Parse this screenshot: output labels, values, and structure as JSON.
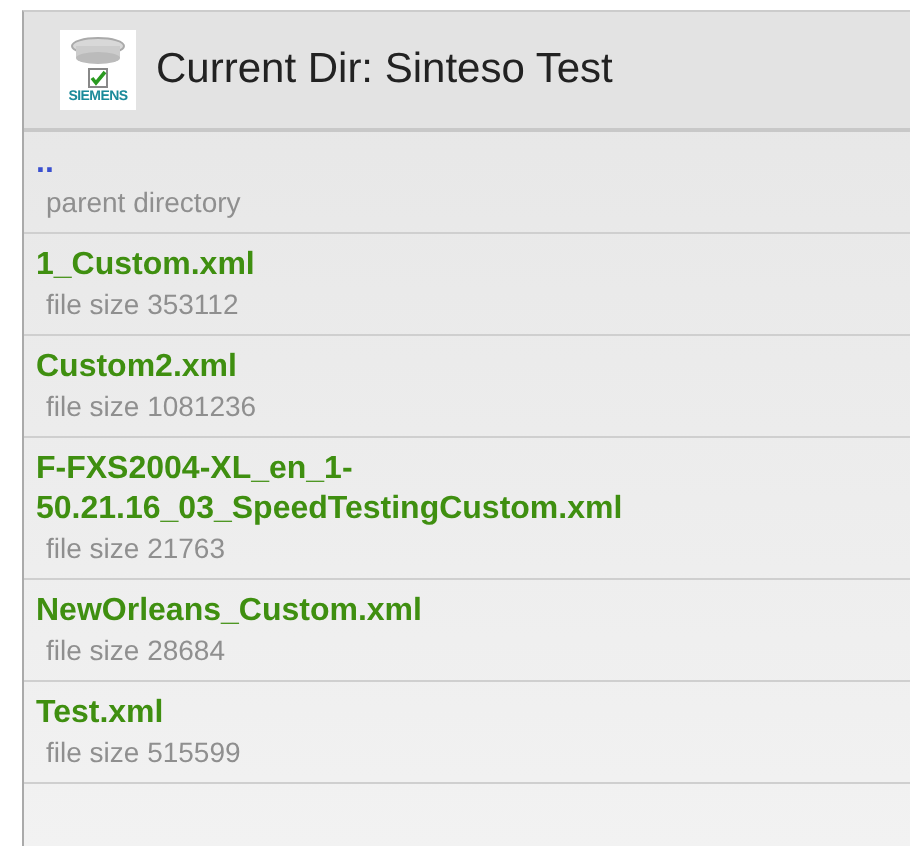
{
  "header": {
    "logo_text": "SIEMENS",
    "title": "Current Dir: Sinteso Test"
  },
  "entries": [
    {
      "kind": "parent",
      "name": "..",
      "detail": "parent directory"
    },
    {
      "kind": "file",
      "name": "1_Custom.xml",
      "detail": "file size 353112"
    },
    {
      "kind": "file",
      "name": "Custom2.xml",
      "detail": "file size 1081236"
    },
    {
      "kind": "file",
      "name": "F-FXS2004-XL_en_1-50.21.16_03_SpeedTestingCustom.xml",
      "detail": "file size 21763"
    },
    {
      "kind": "file",
      "name": "NewOrleans_Custom.xml",
      "detail": "file size 28684"
    },
    {
      "kind": "file",
      "name": "Test.xml",
      "detail": "file size 515599"
    }
  ]
}
